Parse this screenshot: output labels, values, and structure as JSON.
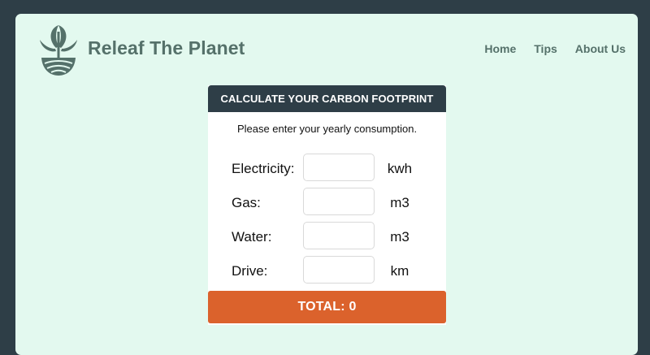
{
  "brand": {
    "name": "Releaf The Planet",
    "logo_icon": "leaf-sprout-globe-icon",
    "color": "#55716a"
  },
  "nav": {
    "items": [
      {
        "label": "Home"
      },
      {
        "label": "Tips"
      },
      {
        "label": "About Us"
      }
    ]
  },
  "calculator": {
    "title": "CALCULATE YOUR CARBON FOOTPRINT",
    "instruction": "Please enter your yearly consumption.",
    "fields": [
      {
        "label": "Electricity:",
        "value": "",
        "unit": "kwh"
      },
      {
        "label": "Gas:",
        "value": "",
        "unit": "m3"
      },
      {
        "label": "Water:",
        "value": "",
        "unit": "m3"
      },
      {
        "label": "Drive:",
        "value": "",
        "unit": "km"
      }
    ],
    "total_label": "TOTAL: 0"
  },
  "colors": {
    "frame": "#2e3e47",
    "page_background": "#e3f9ef",
    "header_bar": "#2e3e47",
    "total_bar": "#db622c"
  }
}
